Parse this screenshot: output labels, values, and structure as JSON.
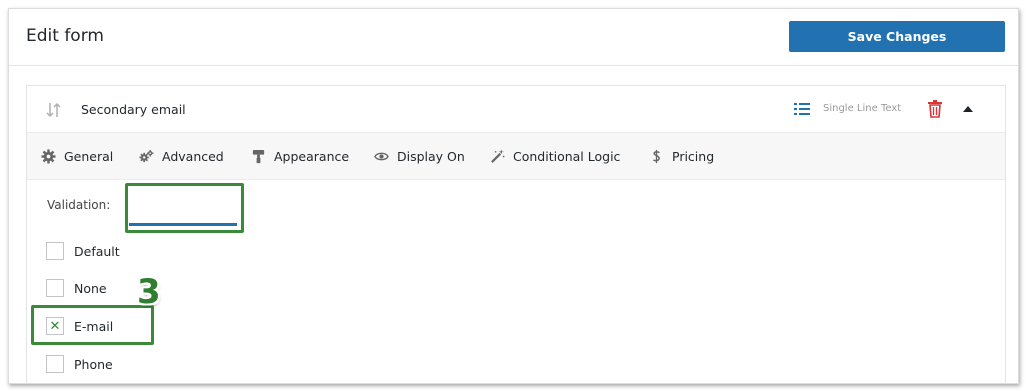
{
  "header": {
    "title": "Edit form",
    "save_label": "Save Changes"
  },
  "field": {
    "name": "Secondary email",
    "type": "Single Line Text",
    "icons": [
      "sort-arrows-icon",
      "list-icon",
      "trash-icon",
      "caret-up-icon"
    ]
  },
  "tabs": [
    {
      "label": "General",
      "icon": "gear-icon"
    },
    {
      "label": "Advanced",
      "icon": "gears-icon",
      "active": true
    },
    {
      "label": "Appearance",
      "icon": "paint-roller-icon"
    },
    {
      "label": "Display On",
      "icon": "eye-icon"
    },
    {
      "label": "Conditional Logic",
      "icon": "magic-wand-icon"
    },
    {
      "label": "Pricing",
      "icon": "dollar-icon"
    }
  ],
  "validation": {
    "label": "Validation:",
    "options": [
      {
        "label": "Default",
        "checked": false
      },
      {
        "label": "None",
        "checked": false
      },
      {
        "label": "E-mail",
        "checked": true
      },
      {
        "label": "Phone",
        "checked": false
      }
    ],
    "checked_mark": "✕"
  },
  "annotation": {
    "step": "3"
  },
  "colors": {
    "primary": "#2271b1",
    "highlight": "#3a8a3a",
    "danger": "#d63638"
  }
}
